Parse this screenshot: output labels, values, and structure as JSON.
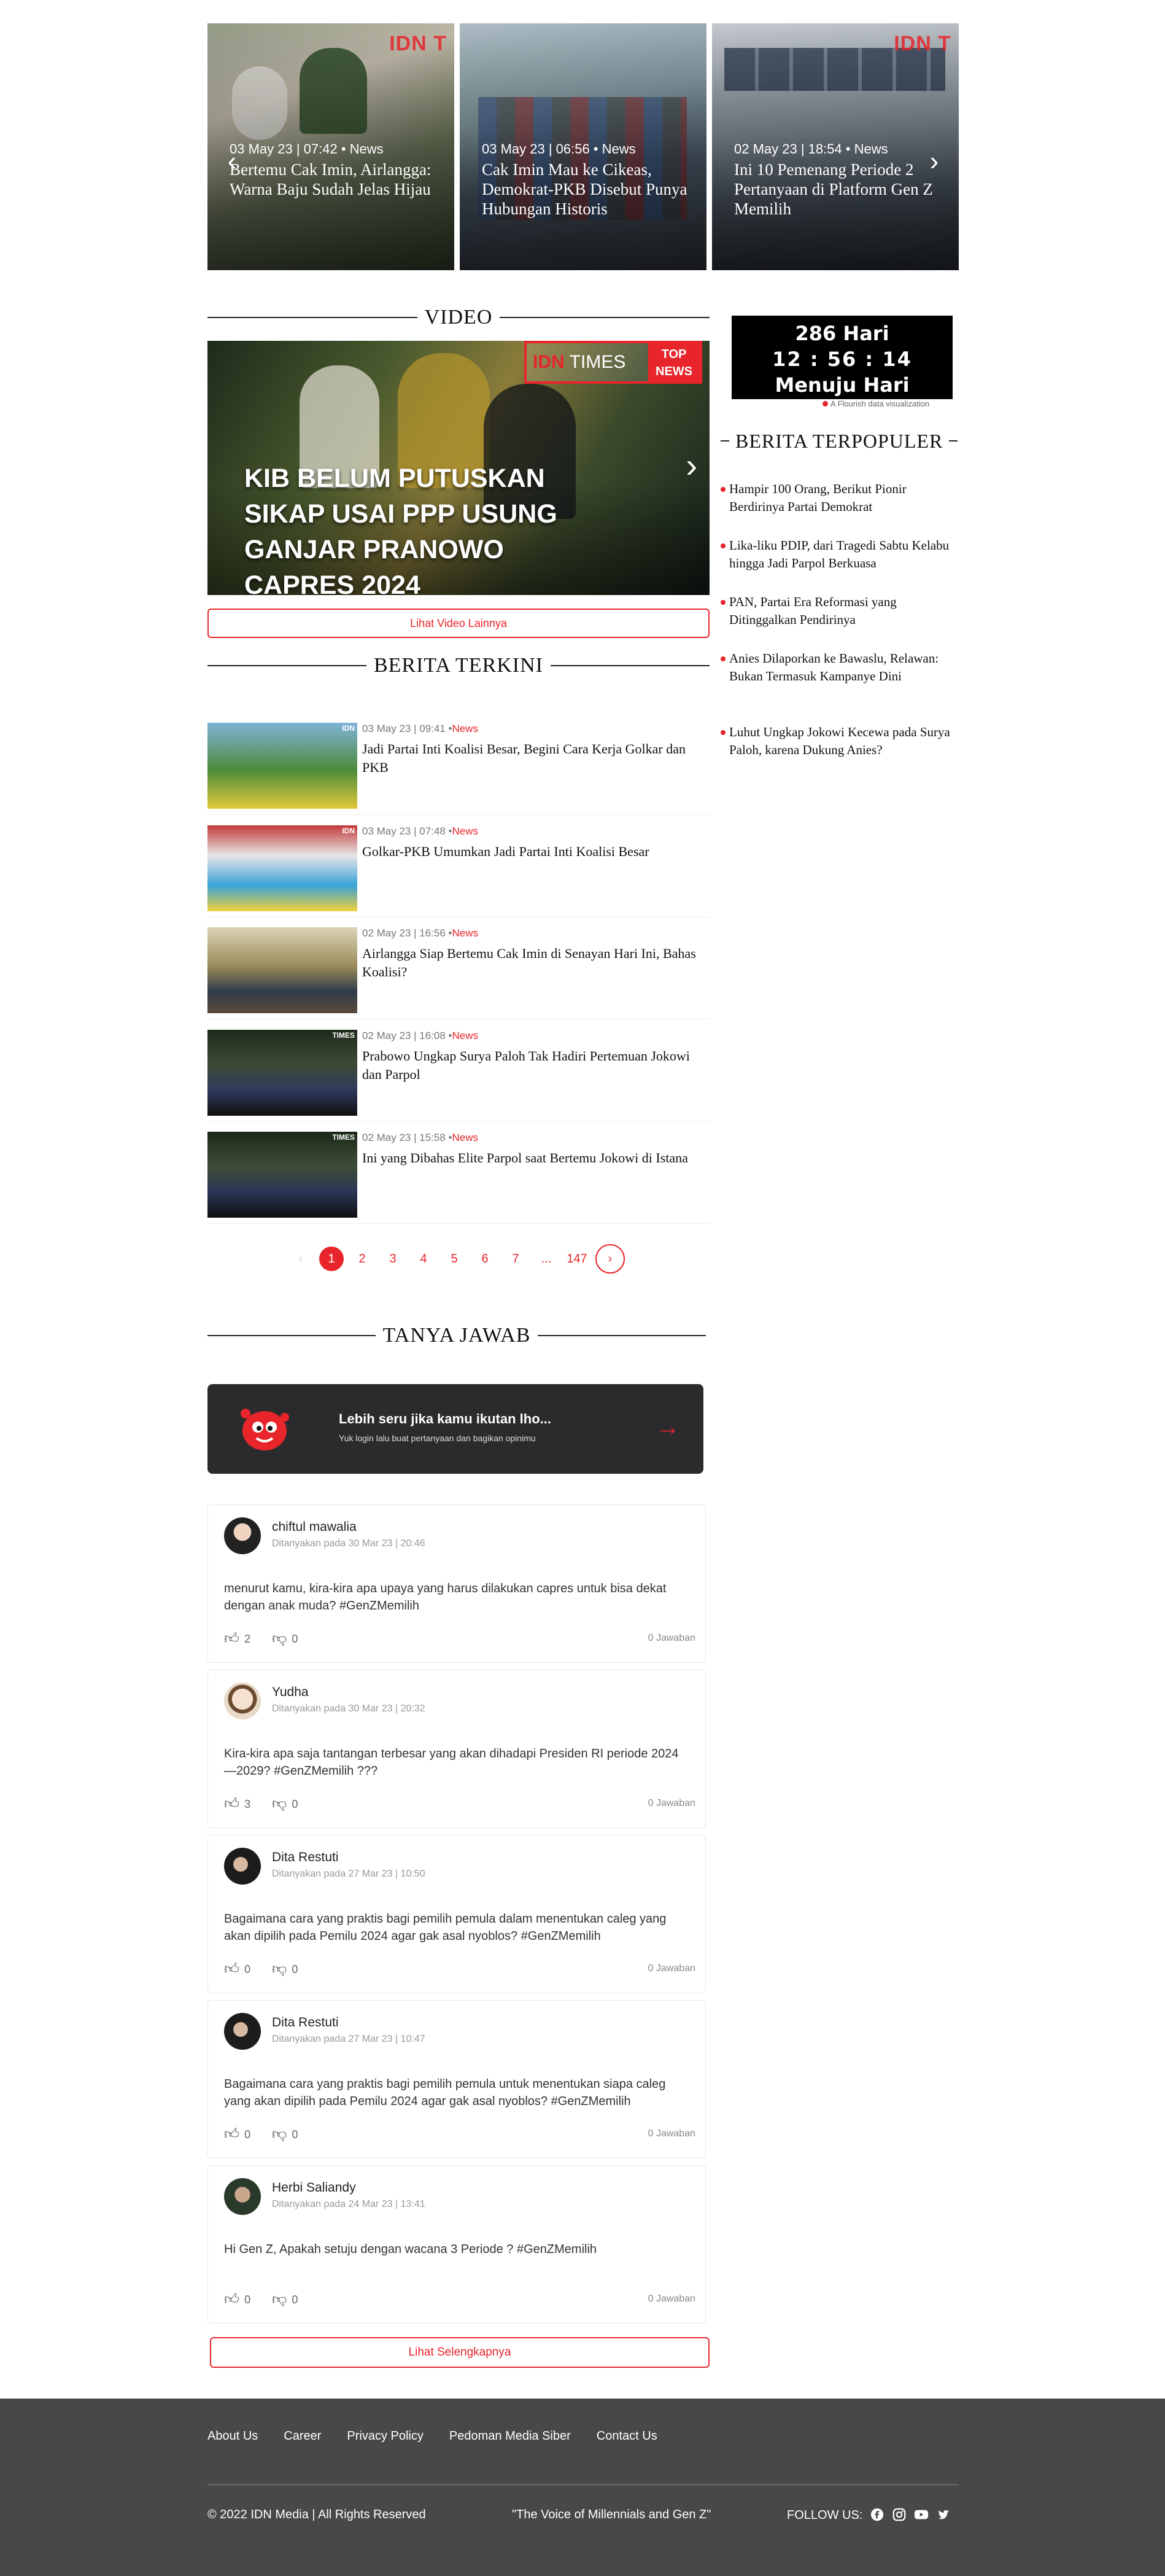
{
  "carousel": {
    "slides": [
      {
        "meta": "03 May 23 | 07:42 • News",
        "title": "Bertemu Cak Imin, Airlangga: Warna Baju Sudah Jelas Hijau"
      },
      {
        "meta": "03 May 23 | 06:56 • News",
        "title": "Cak Imin Mau ke Cikeas, Demokrat-PKB Disebut Punya Hubungan Historis"
      },
      {
        "meta": "02 May 23 | 18:54 • News",
        "title": "Ini 10 Pemenang Periode 2 Pertanyaan di Platform Gen Z Memilih"
      }
    ],
    "watermark": "IDN T"
  },
  "video": {
    "heading": "VIDEO",
    "caption": "KIB BELUM PUTUSKAN SIKAP USAI PPP USUNG GANJAR PRANOWO CAPRES 2024",
    "badge_idn": "IDN",
    "badge_times": "TIMES",
    "badge_top": "TOP",
    "badge_news": "NEWS",
    "more_label": "Lihat Video Lainnya"
  },
  "latest": {
    "heading": "BERITA TERKINI",
    "items": [
      {
        "date": "03 May 23 | 09:41 •",
        "category": "News",
        "title": "Jadi Partai Inti Koalisi Besar, Begini Cara Kerja Golkar dan PKB"
      },
      {
        "date": "03 May 23 | 07:48 •",
        "category": "News",
        "title": "Golkar-PKB Umumkan Jadi Partai Inti Koalisi Besar"
      },
      {
        "date": "02 May 23 | 16:56 •",
        "category": "News",
        "title": "Airlangga Siap Bertemu Cak Imin di Senayan Hari Ini, Bahas Koalisi?"
      },
      {
        "date": "02 May 23 | 16:08 •",
        "category": "News",
        "title": "Prabowo Ungkap Surya Paloh Tak Hadiri Pertemuan Jokowi dan Parpol"
      },
      {
        "date": "02 May 23 | 15:58 •",
        "category": "News",
        "title": "Ini yang Dibahas Elite Parpol saat Bertemu Jokowi di Istana"
      }
    ],
    "pagination": [
      "1",
      "2",
      "3",
      "4",
      "5",
      "6",
      "7",
      "...",
      "147"
    ],
    "prev": "‹",
    "next": "›"
  },
  "countdown": {
    "days": "286 Hari",
    "time": "12 : 56 : 14",
    "label": "Menuju Hari Pencoblosan",
    "credit": "A Flourish data visualization"
  },
  "popular": {
    "heading": "BERITA TERPOPULER",
    "items": [
      "Hampir 100 Orang, Berikut Pionir Berdirinya Partai Demokrat",
      "Lika-liku PDIP, dari Tragedi Sabtu Kelabu hingga Jadi Parpol Berkuasa",
      "PAN, Partai Era Reformasi yang Ditinggalkan Pendirinya",
      "Anies Dilaporkan ke Bawaslu, Relawan: Bukan Termasuk Kampanye Dini",
      "Luhut Ungkap Jokowi Kecewa pada Surya Paloh, karena Dukung Anies?"
    ]
  },
  "qa": {
    "heading": "TANYA JAWAB",
    "banner_title": "Lebih seru jika kamu ikutan lho...",
    "banner_sub": "Yuk login lalu buat pertanyaan dan bagikan opinimu",
    "questions": [
      {
        "user": "chiftul mawalia",
        "date": "Ditanyakan pada 30 Mar 23 | 20:46",
        "text": "menurut kamu, kira-kira apa upaya yang harus dilakukan capres untuk bisa dekat dengan anak muda? #GenZMemilih",
        "likes": "2",
        "dislikes": "0",
        "answers": "0 Jawaban"
      },
      {
        "user": "Yudha",
        "date": "Ditanyakan pada 30 Mar 23 | 20:32",
        "text": "Kira-kira apa saja tantangan terbesar yang akan dihadapi Presiden RI periode 2024—2029? #GenZMemilih ???",
        "likes": "3",
        "dislikes": "0",
        "answers": "0 Jawaban"
      },
      {
        "user": "Dita Restuti",
        "date": "Ditanyakan pada 27 Mar 23 | 10:50",
        "text": "Bagaimana cara yang praktis bagi pemilih pemula dalam menentukan caleg yang akan dipilih pada Pemilu 2024 agar gak asal nyoblos? #GenZMemilih",
        "likes": "0",
        "dislikes": "0",
        "answers": "0 Jawaban"
      },
      {
        "user": "Dita Restuti",
        "date": "Ditanyakan pada 27 Mar 23 | 10:47",
        "text": "Bagaimana cara yang praktis bagi pemilih pemula untuk menentukan siapa caleg yang akan dipilih pada Pemilu 2024 agar gak asal nyoblos? #GenZMemilih",
        "likes": "0",
        "dislikes": "0",
        "answers": "0 Jawaban"
      },
      {
        "user": "Herbi Saliandy",
        "date": "Ditanyakan pada 24 Mar 23 | 13:41",
        "text": "Hi Gen Z, Apakah setuju dengan wacana 3 Periode ? #GenZMemilih",
        "likes": "0",
        "dislikes": "0",
        "answers": "0 Jawaban"
      }
    ],
    "more_label": "Lihat Selengkapnya"
  },
  "footer": {
    "links": [
      "About Us",
      "Career",
      "Privacy Policy",
      "Pedoman Media Siber",
      "Contact Us"
    ],
    "copyright": "© 2022 IDN Media | All Rights Reserved",
    "slogan": "\"The Voice of Millennials and Gen Z\"",
    "follow": "FOLLOW US:",
    "social_icons": [
      "facebook-icon",
      "instagram-icon",
      "youtube-icon",
      "twitter-icon"
    ]
  },
  "colors": {
    "accent": "#e8252b",
    "footer_bg": "#484848",
    "banner_bg": "#2b2b2e"
  }
}
